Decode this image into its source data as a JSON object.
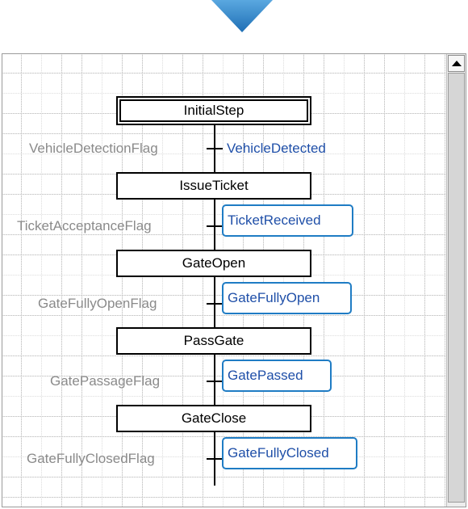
{
  "colors": {
    "indicator_arrow": "#3a8fd0",
    "flag_text": "#8a8a8a",
    "transition_text": "#1f4fa8",
    "highlight_border": "#1f7cc4"
  },
  "icons": {
    "top_indicator": "down-arrow-icon",
    "scroll_up": "triangle-up-icon"
  },
  "steps": [
    {
      "label": "InitialStep"
    },
    {
      "label": "IssueTicket"
    },
    {
      "label": "GateOpen"
    },
    {
      "label": "PassGate"
    },
    {
      "label": "GateClose"
    }
  ],
  "transitions": [
    {
      "flag": "VehicleDetectionFlag",
      "label": "VehicleDetected",
      "highlighted": false
    },
    {
      "flag": "TicketAcceptanceFlag",
      "label": "TicketReceived",
      "highlighted": true
    },
    {
      "flag": "GateFullyOpenFlag",
      "label": "GateFullyOpen",
      "highlighted": true
    },
    {
      "flag": "GatePassageFlag",
      "label": "GatePassed",
      "highlighted": true
    },
    {
      "flag": "GateFullyClosedFlag",
      "label": "GateFullyClosed",
      "highlighted": true
    }
  ]
}
